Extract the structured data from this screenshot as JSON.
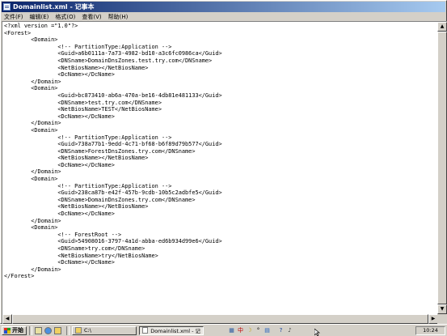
{
  "window": {
    "title": "Domainlist.xml - 记事本"
  },
  "menu": [
    "文件(F)",
    "编辑(E)",
    "格式(O)",
    "查看(V)",
    "帮助(H)"
  ],
  "document": {
    "lines": [
      "<?xml version =\"1.0\"?>",
      "<Forest>",
      "        <Domain>",
      "                <!-- PartitionType:Application -->",
      "                <Guid>a6b0111a-7a73-4982-bd10-a3c6fc0986ca</Guid>",
      "                <DNSname>DomainDnsZones.test.try.com</DNSname>",
      "                <NetBiosName></NetBiosName>",
      "                <DcName></DcName>",
      "        </Domain>",
      "        <Domain>",
      "                <Guid>bc873410-ab6a-470a-be16-4db81e481133</Guid>",
      "                <DNSname>test.try.com</DNSname>",
      "                <NetBiosName>TEST</NetBiosName>",
      "                <DcName></DcName>",
      "        </Domain>",
      "        <Domain>",
      "                <!-- PartitionType:Application -->",
      "                <Guid>738a77b1-9edd-4c71-bf68-b6f89d79b577</Guid>",
      "                <DNSname>ForestDnsZones.try.com</DNSname>",
      "                <NetBiosName></NetBiosName>",
      "                <DcName></DcName>",
      "        </Domain>",
      "        <Domain>",
      "                <!-- PartitionType:Application -->",
      "                <Guid>238ca87b-e42f-457b-9cdb-10b5c2adbfe5</Guid>",
      "                <DNSname>DomainDnsZones.try.com</DNSname>",
      "                <NetBiosName></NetBiosName>",
      "                <DcName></DcName>",
      "        </Domain>",
      "        <Domain>",
      "                <!-- ForestRoot -->",
      "                <Guid>54908016-3797-4a1d-abba-ed6b934d99e6</Guid>",
      "                <DNSname>try.com</DNSname>",
      "                <NetBiosName>try</NetBiosName>",
      "                <DcName></DcName>",
      "        </Domain>",
      "</Forest>"
    ]
  },
  "taskbar": {
    "start_label": "开始",
    "tasks": [
      {
        "label": "C:\\",
        "icon": "folder-icon",
        "active": false
      },
      {
        "label": "Domainlist.xml - 记",
        "icon": "notepad-icon",
        "active": true
      }
    ],
    "tray_icons": [
      {
        "glyph": "▦",
        "color": "#2a5aa0",
        "icon": "keyboard-icon"
      },
      {
        "glyph": "中",
        "color": "#c00000",
        "icon": "ime-chinese-icon"
      },
      {
        "glyph": "☽",
        "color": "#c0a000",
        "icon": "half-width-icon"
      },
      {
        "glyph": "°",
        "color": "#000000",
        "icon": "punctuation-icon"
      },
      {
        "glyph": "▤",
        "color": "#2060c0",
        "icon": "soft-keyboard-icon"
      },
      {
        "glyph": "?",
        "color": "#1040a0",
        "icon": "help-icon"
      },
      {
        "glyph": "♪",
        "color": "#404040",
        "icon": "volume-icon"
      }
    ],
    "clock": "10:24"
  }
}
